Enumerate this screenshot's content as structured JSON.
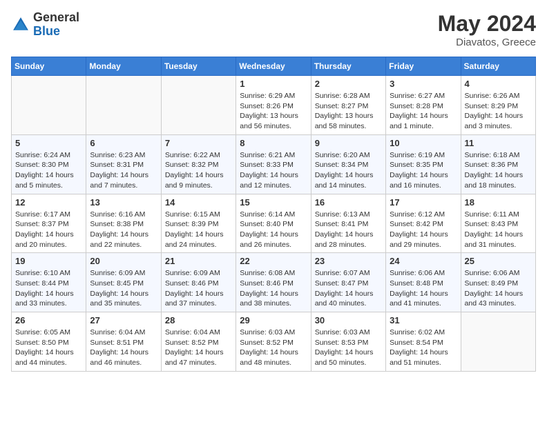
{
  "header": {
    "logo_general": "General",
    "logo_blue": "Blue",
    "month_year": "May 2024",
    "location": "Diavatos, Greece"
  },
  "days_of_week": [
    "Sunday",
    "Monday",
    "Tuesday",
    "Wednesday",
    "Thursday",
    "Friday",
    "Saturday"
  ],
  "weeks": [
    [
      {
        "day": "",
        "sunrise": "",
        "sunset": "",
        "daylight": ""
      },
      {
        "day": "",
        "sunrise": "",
        "sunset": "",
        "daylight": ""
      },
      {
        "day": "",
        "sunrise": "",
        "sunset": "",
        "daylight": ""
      },
      {
        "day": "1",
        "sunrise": "Sunrise: 6:29 AM",
        "sunset": "Sunset: 8:26 PM",
        "daylight": "Daylight: 13 hours and 56 minutes."
      },
      {
        "day": "2",
        "sunrise": "Sunrise: 6:28 AM",
        "sunset": "Sunset: 8:27 PM",
        "daylight": "Daylight: 13 hours and 58 minutes."
      },
      {
        "day": "3",
        "sunrise": "Sunrise: 6:27 AM",
        "sunset": "Sunset: 8:28 PM",
        "daylight": "Daylight: 14 hours and 1 minute."
      },
      {
        "day": "4",
        "sunrise": "Sunrise: 6:26 AM",
        "sunset": "Sunset: 8:29 PM",
        "daylight": "Daylight: 14 hours and 3 minutes."
      }
    ],
    [
      {
        "day": "5",
        "sunrise": "Sunrise: 6:24 AM",
        "sunset": "Sunset: 8:30 PM",
        "daylight": "Daylight: 14 hours and 5 minutes."
      },
      {
        "day": "6",
        "sunrise": "Sunrise: 6:23 AM",
        "sunset": "Sunset: 8:31 PM",
        "daylight": "Daylight: 14 hours and 7 minutes."
      },
      {
        "day": "7",
        "sunrise": "Sunrise: 6:22 AM",
        "sunset": "Sunset: 8:32 PM",
        "daylight": "Daylight: 14 hours and 9 minutes."
      },
      {
        "day": "8",
        "sunrise": "Sunrise: 6:21 AM",
        "sunset": "Sunset: 8:33 PM",
        "daylight": "Daylight: 14 hours and 12 minutes."
      },
      {
        "day": "9",
        "sunrise": "Sunrise: 6:20 AM",
        "sunset": "Sunset: 8:34 PM",
        "daylight": "Daylight: 14 hours and 14 minutes."
      },
      {
        "day": "10",
        "sunrise": "Sunrise: 6:19 AM",
        "sunset": "Sunset: 8:35 PM",
        "daylight": "Daylight: 14 hours and 16 minutes."
      },
      {
        "day": "11",
        "sunrise": "Sunrise: 6:18 AM",
        "sunset": "Sunset: 8:36 PM",
        "daylight": "Daylight: 14 hours and 18 minutes."
      }
    ],
    [
      {
        "day": "12",
        "sunrise": "Sunrise: 6:17 AM",
        "sunset": "Sunset: 8:37 PM",
        "daylight": "Daylight: 14 hours and 20 minutes."
      },
      {
        "day": "13",
        "sunrise": "Sunrise: 6:16 AM",
        "sunset": "Sunset: 8:38 PM",
        "daylight": "Daylight: 14 hours and 22 minutes."
      },
      {
        "day": "14",
        "sunrise": "Sunrise: 6:15 AM",
        "sunset": "Sunset: 8:39 PM",
        "daylight": "Daylight: 14 hours and 24 minutes."
      },
      {
        "day": "15",
        "sunrise": "Sunrise: 6:14 AM",
        "sunset": "Sunset: 8:40 PM",
        "daylight": "Daylight: 14 hours and 26 minutes."
      },
      {
        "day": "16",
        "sunrise": "Sunrise: 6:13 AM",
        "sunset": "Sunset: 8:41 PM",
        "daylight": "Daylight: 14 hours and 28 minutes."
      },
      {
        "day": "17",
        "sunrise": "Sunrise: 6:12 AM",
        "sunset": "Sunset: 8:42 PM",
        "daylight": "Daylight: 14 hours and 29 minutes."
      },
      {
        "day": "18",
        "sunrise": "Sunrise: 6:11 AM",
        "sunset": "Sunset: 8:43 PM",
        "daylight": "Daylight: 14 hours and 31 minutes."
      }
    ],
    [
      {
        "day": "19",
        "sunrise": "Sunrise: 6:10 AM",
        "sunset": "Sunset: 8:44 PM",
        "daylight": "Daylight: 14 hours and 33 minutes."
      },
      {
        "day": "20",
        "sunrise": "Sunrise: 6:09 AM",
        "sunset": "Sunset: 8:45 PM",
        "daylight": "Daylight: 14 hours and 35 minutes."
      },
      {
        "day": "21",
        "sunrise": "Sunrise: 6:09 AM",
        "sunset": "Sunset: 8:46 PM",
        "daylight": "Daylight: 14 hours and 37 minutes."
      },
      {
        "day": "22",
        "sunrise": "Sunrise: 6:08 AM",
        "sunset": "Sunset: 8:46 PM",
        "daylight": "Daylight: 14 hours and 38 minutes."
      },
      {
        "day": "23",
        "sunrise": "Sunrise: 6:07 AM",
        "sunset": "Sunset: 8:47 PM",
        "daylight": "Daylight: 14 hours and 40 minutes."
      },
      {
        "day": "24",
        "sunrise": "Sunrise: 6:06 AM",
        "sunset": "Sunset: 8:48 PM",
        "daylight": "Daylight: 14 hours and 41 minutes."
      },
      {
        "day": "25",
        "sunrise": "Sunrise: 6:06 AM",
        "sunset": "Sunset: 8:49 PM",
        "daylight": "Daylight: 14 hours and 43 minutes."
      }
    ],
    [
      {
        "day": "26",
        "sunrise": "Sunrise: 6:05 AM",
        "sunset": "Sunset: 8:50 PM",
        "daylight": "Daylight: 14 hours and 44 minutes."
      },
      {
        "day": "27",
        "sunrise": "Sunrise: 6:04 AM",
        "sunset": "Sunset: 8:51 PM",
        "daylight": "Daylight: 14 hours and 46 minutes."
      },
      {
        "day": "28",
        "sunrise": "Sunrise: 6:04 AM",
        "sunset": "Sunset: 8:52 PM",
        "daylight": "Daylight: 14 hours and 47 minutes."
      },
      {
        "day": "29",
        "sunrise": "Sunrise: 6:03 AM",
        "sunset": "Sunset: 8:52 PM",
        "daylight": "Daylight: 14 hours and 48 minutes."
      },
      {
        "day": "30",
        "sunrise": "Sunrise: 6:03 AM",
        "sunset": "Sunset: 8:53 PM",
        "daylight": "Daylight: 14 hours and 50 minutes."
      },
      {
        "day": "31",
        "sunrise": "Sunrise: 6:02 AM",
        "sunset": "Sunset: 8:54 PM",
        "daylight": "Daylight: 14 hours and 51 minutes."
      },
      {
        "day": "",
        "sunrise": "",
        "sunset": "",
        "daylight": ""
      }
    ]
  ]
}
